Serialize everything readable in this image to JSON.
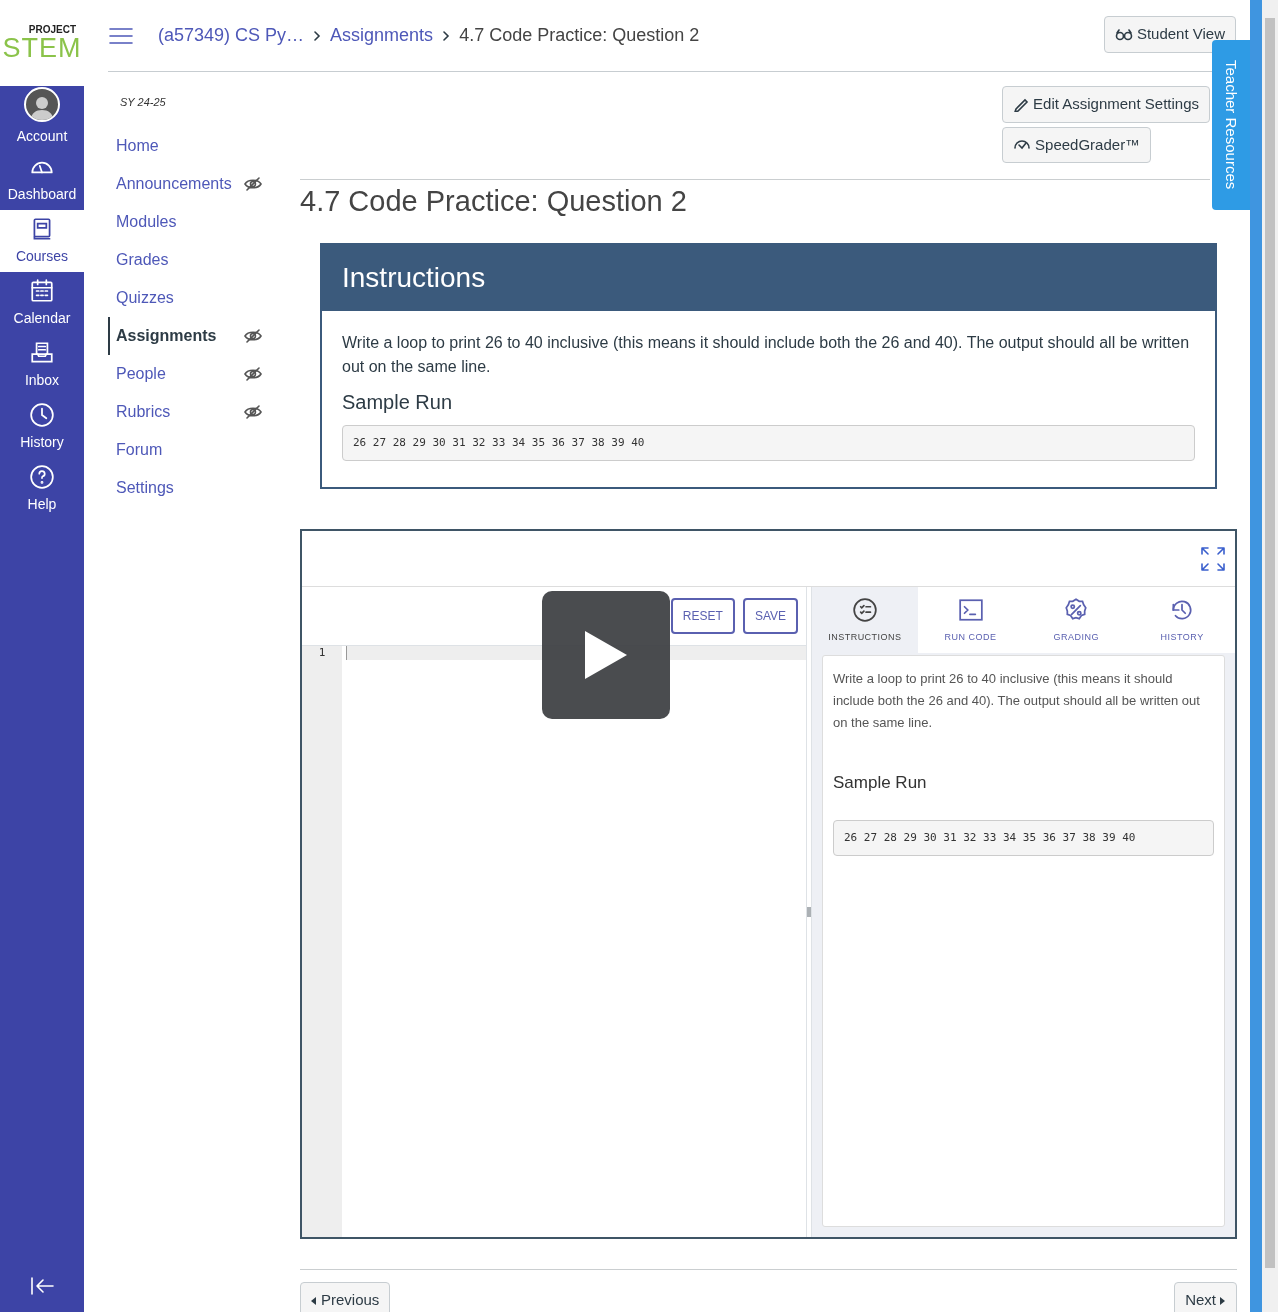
{
  "logo": {
    "top": "PROJECT",
    "main": "STEM"
  },
  "global_nav": [
    {
      "label": "Account",
      "kind": "avatar",
      "selected": false
    },
    {
      "label": "Dashboard",
      "kind": "dashboard",
      "selected": false
    },
    {
      "label": "Courses",
      "kind": "courses",
      "selected": true
    },
    {
      "label": "Calendar",
      "kind": "calendar",
      "selected": false
    },
    {
      "label": "Inbox",
      "kind": "inbox",
      "selected": false
    },
    {
      "label": "History",
      "kind": "history",
      "selected": false
    },
    {
      "label": "Help",
      "kind": "help",
      "selected": false
    }
  ],
  "breadcrumbs": {
    "links": [
      "(a57349) CS Py…",
      "Assignments"
    ],
    "current": "4.7 Code Practice: Question 2"
  },
  "student_view_button": "Student View",
  "teacher_resources_tab": "Teacher Resources",
  "course_nav": {
    "term": "SY 24-25",
    "items": [
      {
        "label": "Home",
        "selected": false,
        "hidden": false
      },
      {
        "label": "Announcements",
        "selected": false,
        "hidden": true
      },
      {
        "label": "Modules",
        "selected": false,
        "hidden": false
      },
      {
        "label": "Grades",
        "selected": false,
        "hidden": false
      },
      {
        "label": "Quizzes",
        "selected": false,
        "hidden": false
      },
      {
        "label": "Assignments",
        "selected": true,
        "hidden": true
      },
      {
        "label": "People",
        "selected": false,
        "hidden": true
      },
      {
        "label": "Rubrics",
        "selected": false,
        "hidden": true
      },
      {
        "label": "Forum",
        "selected": false,
        "hidden": false
      },
      {
        "label": "Settings",
        "selected": false,
        "hidden": false
      }
    ]
  },
  "actions": [
    {
      "label": "Edit Assignment Settings",
      "kind": "edit"
    },
    {
      "label": "SpeedGrader™",
      "kind": "grader"
    }
  ],
  "title": "4.7 Code Practice: Question 2",
  "instructions": {
    "heading": "Instructions",
    "text": "Write a loop to print 26 to 40 inclusive (this means it should include both the 26 and 40). The output should all be written out on the same line.",
    "sample_heading": "Sample Run",
    "sample_output": "26 27 28 29 30 31 32 33 34 35 36 37 38 39 40"
  },
  "ide": {
    "buttons": [
      "RESET",
      "SAVE"
    ],
    "line_numbers": [
      "1"
    ],
    "tabs": [
      {
        "label": "INSTRUCTIONS",
        "kind": "instructions",
        "selected": true
      },
      {
        "label": "RUN CODE",
        "kind": "terminal",
        "selected": false
      },
      {
        "label": "GRADING",
        "kind": "grading",
        "selected": false
      },
      {
        "label": "HISTORY",
        "kind": "history",
        "selected": false
      }
    ],
    "panel": {
      "text": "Write a loop to print 26 to 40 inclusive (this means it should include both the 26 and 40). The output should all be written out on the same line.",
      "sample_heading": "Sample Run",
      "sample_output": "26 27 28 29 30 31 32 33 34 35 36 37 38 39 40"
    }
  },
  "pager": {
    "previous": "Previous",
    "next": "Next"
  }
}
